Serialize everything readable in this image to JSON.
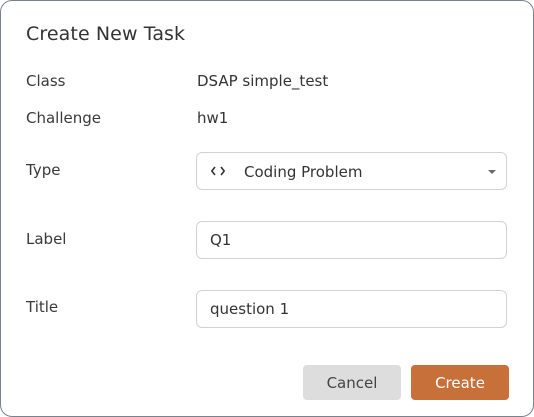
{
  "dialog": {
    "title": "Create New Task",
    "class_label": "Class",
    "class_value": "DSAP simple_test",
    "challenge_label": "Challenge",
    "challenge_value": "hw1",
    "type_label": "Type",
    "type_value": "Coding Problem",
    "type_icon": "code-icon",
    "label_label": "Label",
    "label_value": "Q1",
    "title_label": "Title",
    "title_value": "question 1",
    "cancel_label": "Cancel",
    "create_label": "Create"
  },
  "colors": {
    "accent": "#c8703a",
    "cancel_bg": "#dddddd",
    "border": "#cfd3d9"
  }
}
